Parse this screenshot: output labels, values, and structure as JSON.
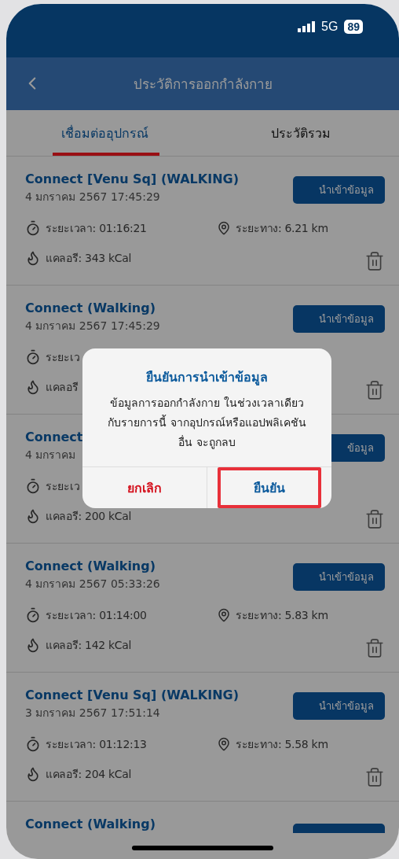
{
  "status_bar": {
    "network": "5G",
    "battery": "89"
  },
  "header": {
    "title": "ประวัติการออกกำลังกาย"
  },
  "tabs": [
    {
      "label": "เชื่อมต่ออุปกรณ์",
      "selected": true
    },
    {
      "label": "ประวัติรวม",
      "selected": false
    }
  ],
  "workouts": [
    {
      "kind": "full",
      "title": "Connect [Venu Sq] (WALKING)",
      "date": "4 มกราคม 2567 17:45:29",
      "import_button": "นำเข้าข้อมูล",
      "duration": "ระยะเวลา: 01:16:21",
      "distance": "ระยะทาง: 6.21 km",
      "calories": "แคลอรี: 343 kCal"
    },
    {
      "kind": "full",
      "title": "Connect (Walking)",
      "date": "4 มกราคม 2567 17:45:29",
      "import_button": "นำเข้าข้อมูล",
      "duration": "ระยะเว",
      "calories": "แคลอรี"
    },
    {
      "kind": "full",
      "title": "Connect",
      "date": "4 มกราคม",
      "import_button": "ข้อมูล",
      "duration": "ระยะเว",
      "calories": "แคลอรี: 200 kCal"
    },
    {
      "kind": "full",
      "title": "Connect (Walking)",
      "date": "4 มกราคม 2567 05:33:26",
      "import_button": "นำเข้าข้อมูล",
      "duration": "ระยะเวลา: 01:14:00",
      "distance": "ระยะทาง: 5.83 km",
      "calories": "แคลอรี: 142 kCal"
    },
    {
      "kind": "full",
      "title": "Connect [Venu Sq] (WALKING)",
      "date": "3 มกราคม 2567 17:51:14",
      "import_button": "นำเข้าข้อมูล",
      "duration": "ระยะเวลา: 01:12:13",
      "distance": "ระยะทาง: 5.58 km",
      "calories": "แคลอรี: 204 kCal"
    },
    {
      "kind": "partial",
      "title": "Connect (Walking)"
    }
  ],
  "dialog": {
    "title": "ยืนยันการนำเข้าข้อมูล",
    "message": "ข้อมูลการออกกำลังกาย ในช่วงเวลาเดียวกับรายการนี้ จากอุปกรณ์หรือแอปพลิเคชันอื่น จะถูกลบ",
    "buttons": [
      {
        "kind": "cancel",
        "label": "ยกเลิก",
        "highlighted": false
      },
      {
        "kind": "confirm",
        "label": "ยืนยัน",
        "highlighted": true
      }
    ]
  }
}
